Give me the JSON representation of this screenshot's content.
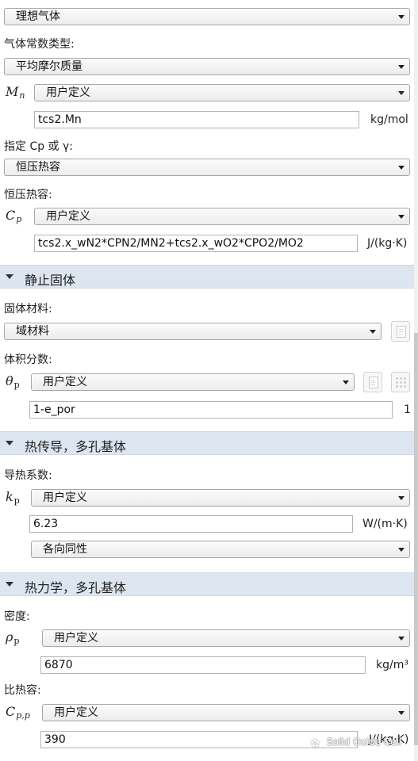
{
  "fluid": {
    "model_value": "理想气体",
    "gas_const_label": "气体常数类型:",
    "gas_const_value": "平均摩尔质量",
    "mn_symbol": "M",
    "mn_sub": "n",
    "mn_combo_value": "用户定义",
    "mn_expression": "tcs2.Mn",
    "mn_unit": "kg/mol",
    "specify_label": "指定 Cp 或 γ:",
    "specify_value": "恒压热容",
    "cp_label": "恒压热容:",
    "cp_symbol": "C",
    "cp_sub": "p",
    "cp_combo_value": "用户定义",
    "cp_expression": "tcs2.x_wN2*CPN2/MN2+tcs2.x_wO2*CPO2/MO2",
    "cp_unit": "J/(kg·K)"
  },
  "solid_section": {
    "title": "静止固体",
    "material_label": "固体材料:",
    "material_value": "域材料",
    "volfrac_label": "体积分数:",
    "theta_symbol": "θ",
    "theta_sub": "p",
    "theta_combo_value": "用户定义",
    "theta_expression": "1-e_por",
    "theta_unit": "1"
  },
  "conduction_section": {
    "title": "热传导，多孔基体",
    "conductivity_label": "导热系数:",
    "k_symbol": "k",
    "k_sub": "p",
    "k_combo_value": "用户定义",
    "k_value": "6.23",
    "k_unit": "W/(m·K)",
    "k_type_value": "各向同性"
  },
  "thermo_section": {
    "title": "热力学，多孔基体",
    "density_label": "密度:",
    "rho_symbol": "ρ",
    "rho_sub": "p",
    "rho_combo_value": "用户定义",
    "rho_value": "6870",
    "rho_unit": "kg/m³",
    "heatcap_label": "比热容:",
    "cpp_symbol": "C",
    "cpp_sub": "p,p",
    "cpp_combo_value": "用户定义",
    "cpp_value": "390",
    "cpp_unit": "J/(kg·K)"
  },
  "watermark": {
    "icon": "wechat-icon",
    "text": "Solid Oxide Cell"
  },
  "icons": {
    "dropdown": "chevron-down-icon",
    "section_toggle": "triangle-down-icon",
    "material_link": "material-link-icon",
    "variable_button": "variable-list-icon",
    "matrix_button": "matrix-grid-icon"
  }
}
